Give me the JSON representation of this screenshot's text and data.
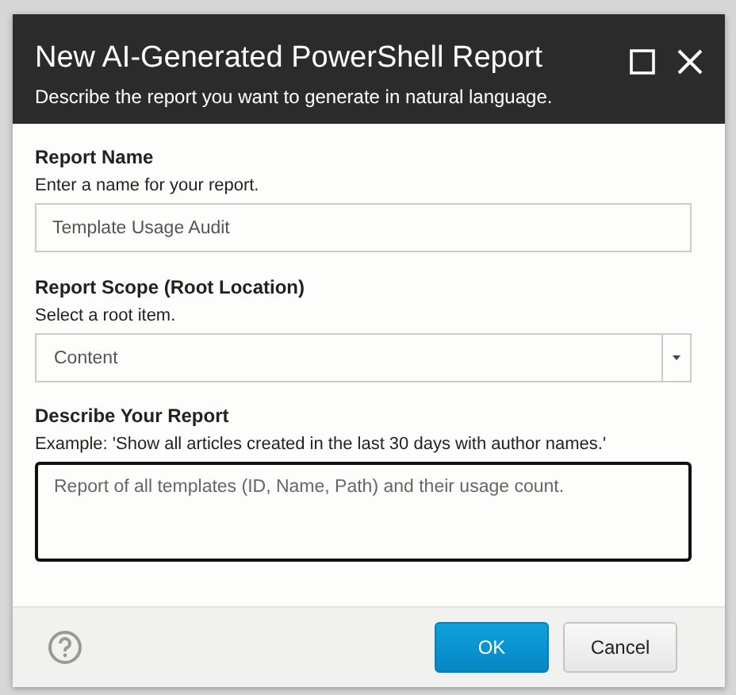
{
  "dialog": {
    "title": "New AI-Generated PowerShell Report",
    "subtitle": "Describe the report you want to generate in natural language.",
    "maximized": false
  },
  "fields": [
    {
      "kind": "text",
      "label": "Report Name",
      "hint": "Enter a name for your report.",
      "value": "Template Usage Audit",
      "focused": false
    },
    {
      "kind": "select",
      "label": "Report Scope (Root Location)",
      "hint": "Select a root item.",
      "value": "Content",
      "focused": false
    },
    {
      "kind": "textarea",
      "label": "Describe Your Report",
      "hint": "Example: 'Show all articles created in the last 30 days with author names.'",
      "value": "Report of all templates (ID, Name, Path) and their usage count.",
      "focused": true
    }
  ],
  "buttons": [
    {
      "label": "OK",
      "primary": true
    },
    {
      "label": "Cancel",
      "primary": false
    }
  ]
}
